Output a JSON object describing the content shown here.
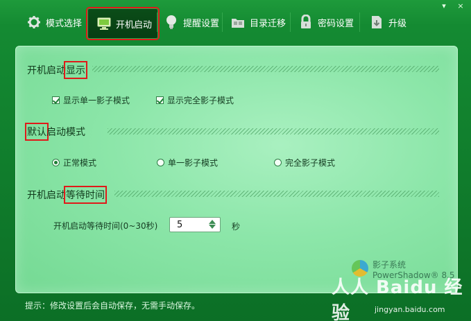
{
  "window": {
    "controls": [
      "▾",
      "×"
    ]
  },
  "nav": {
    "tabs": [
      {
        "id": "mode",
        "label": "模式选择",
        "icon": "gear-icon"
      },
      {
        "id": "boot",
        "label": "开机启动",
        "icon": "monitor-icon",
        "active": true
      },
      {
        "id": "remind",
        "label": "提醒设置",
        "icon": "bulb-icon"
      },
      {
        "id": "migrate",
        "label": "目录迁移",
        "icon": "folder-icon"
      },
      {
        "id": "password",
        "label": "密码设置",
        "icon": "lock-icon"
      },
      {
        "id": "upgrade",
        "label": "升级",
        "icon": "download-icon"
      }
    ]
  },
  "sections": {
    "display": {
      "title_prefix": "开机启动",
      "title_highlight": "显示",
      "options": [
        {
          "label": "显示单一影子模式",
          "checked": true
        },
        {
          "label": "显示完全影子模式",
          "checked": true
        }
      ]
    },
    "default_mode": {
      "title_highlight": "默认",
      "title_suffix": "启动模式",
      "options": [
        {
          "label": "正常模式",
          "selected": true
        },
        {
          "label": "单一影子模式",
          "selected": false
        },
        {
          "label": "完全影子模式",
          "selected": false
        }
      ]
    },
    "wait": {
      "title_prefix": "开机启动",
      "title_highlight": "等待时间",
      "field_label": "开机启动等待时间(0~30秒)",
      "value": "5",
      "unit": "秒"
    }
  },
  "brand": {
    "line1": "影子系统",
    "line2": "PowerShadow® 8.5"
  },
  "footer": {
    "hint": "提示：修改设置后会自动保存，无需手动保存。"
  },
  "watermark": {
    "main": "人人 Baidu 经验",
    "sub": "jingyan.baidu.com"
  },
  "colors": {
    "accent": "#e01919",
    "frame": "#148a32",
    "panel": "#8ce6a9"
  }
}
